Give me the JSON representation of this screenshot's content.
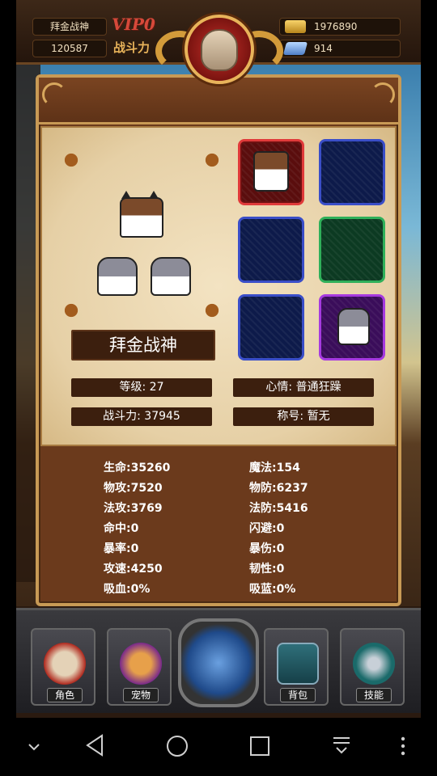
{
  "header": {
    "player_name": "拜金战神",
    "player_id": "120587",
    "vip_label": "VIP0",
    "power_label": "战斗力",
    "gold": "1976890",
    "gems": "914"
  },
  "pet": {
    "name": "拜金战神",
    "level_text": "等级: 27",
    "mood_text": "心情: 普通狂躁",
    "power_text": "战斗力: 37945",
    "title_text": "称号: 暂无"
  },
  "slots": [
    {
      "rarity": "red",
      "occupied": true,
      "icon": "cat-icon"
    },
    {
      "rarity": "blue",
      "occupied": false
    },
    {
      "rarity": "blue",
      "occupied": false
    },
    {
      "rarity": "green",
      "occupied": false
    },
    {
      "rarity": "blue",
      "occupied": false
    },
    {
      "rarity": "purple",
      "occupied": true,
      "icon": "hamster-icon"
    }
  ],
  "stats": {
    "left": [
      "生命:35260",
      "物攻:7520",
      "法攻:3769",
      "命中:0",
      "暴率:0",
      "攻速:4250",
      "吸血:0%"
    ],
    "right": [
      "魔法:154",
      "物防:6237",
      "法防:5416",
      "闪避:0",
      "暴伤:0",
      "韧性:0",
      "吸蓝:0%"
    ]
  },
  "dock": {
    "role": "角色",
    "pet": "宠物",
    "bag": "背包",
    "skill": "技能"
  },
  "colors": {
    "panel": "#6b3a1c",
    "frame": "#c89a55",
    "label_bg": "#3c1f0e"
  }
}
